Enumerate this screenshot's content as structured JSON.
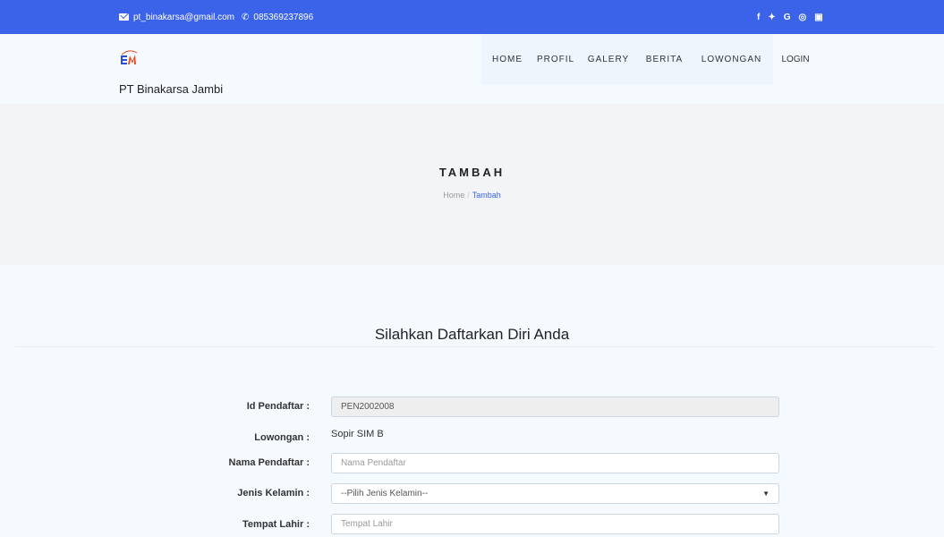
{
  "topbar": {
    "email": "pt_binakarsa@gmail.com",
    "phone": "085369237896",
    "socials": [
      "f",
      "t",
      "G",
      "o",
      "y"
    ]
  },
  "header": {
    "brand": "PT Binakarsa Jambi",
    "nav": [
      "HOME",
      "PROFIL",
      "GALERY",
      "BERITA",
      "LOWONGAN",
      "LOGIN"
    ]
  },
  "hero": {
    "title": "TAMBAH",
    "breadcrumb_home": "Home",
    "breadcrumb_sep": "/",
    "breadcrumb_current": "Tambah"
  },
  "form": {
    "title": "Silahkan Daftarkan Diri Anda",
    "id_label": "Id Pendaftar :",
    "id_value": "PEN2002008",
    "lowongan_label": "Lowongan :",
    "lowongan_value": "Sopir SIM B",
    "nama_label": "Nama Pendaftar :",
    "nama_placeholder": "Nama Pendaftar",
    "jk_label": "Jenis Kelamin :",
    "jk_selected": "--Pilih Jenis Kelamin--",
    "tempat_label": "Tempat Lahir :",
    "tempat_placeholder": "Tempat Lahir"
  },
  "colors": {
    "topbar": "#3b63ea",
    "hero": "#f3f4f6",
    "page": "#f5faff",
    "link": "#3b63ea"
  }
}
